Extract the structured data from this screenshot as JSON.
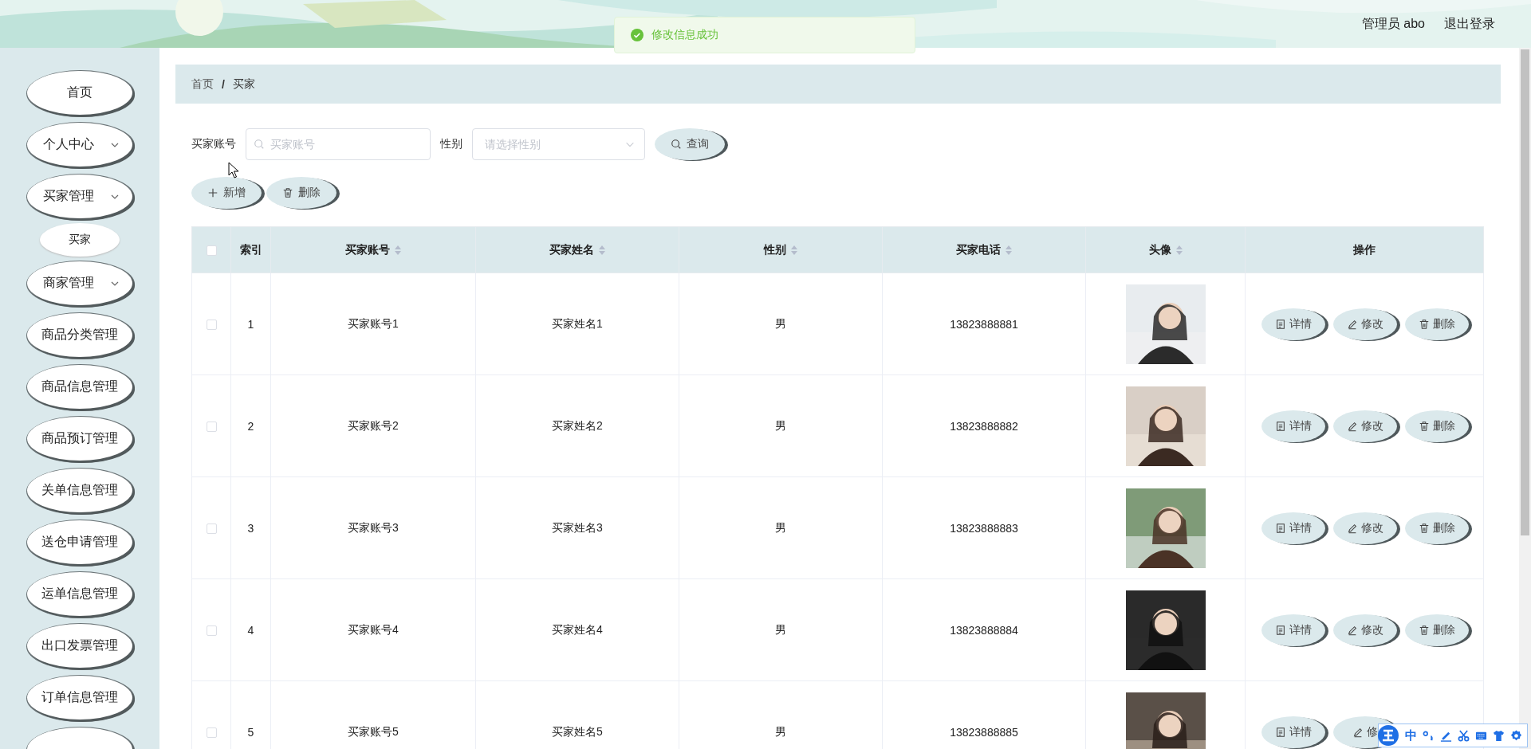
{
  "header": {
    "user": "管理员 abo",
    "logout": "退出登录"
  },
  "toast": {
    "kind": "success",
    "message": "修改信息成功"
  },
  "sidebar": {
    "items": [
      {
        "label": "首页",
        "kind": "link"
      },
      {
        "label": "个人中心",
        "kind": "submenu"
      },
      {
        "label": "买家管理",
        "kind": "submenu",
        "children": [
          {
            "label": "买家"
          }
        ]
      },
      {
        "label": "商家管理",
        "kind": "submenu"
      },
      {
        "label": "商品分类管理",
        "kind": "link"
      },
      {
        "label": "商品信息管理",
        "kind": "link"
      },
      {
        "label": "商品预订管理",
        "kind": "link"
      },
      {
        "label": "关单信息管理",
        "kind": "link"
      },
      {
        "label": "送仓申请管理",
        "kind": "link"
      },
      {
        "label": "运单信息管理",
        "kind": "link"
      },
      {
        "label": "出口发票管理",
        "kind": "link"
      },
      {
        "label": "订单信息管理",
        "kind": "link"
      },
      {
        "kind": "link"
      }
    ]
  },
  "breadcrumb": {
    "items": [
      "首页",
      "买家"
    ],
    "separator": "/"
  },
  "filters": {
    "account": {
      "label": "买家账号",
      "placeholder": "买家账号"
    },
    "gender": {
      "label": "性别",
      "placeholder": "请选择性别"
    },
    "search_button": "查询"
  },
  "toolbar": [
    {
      "kind": "add",
      "label": "新增"
    },
    {
      "kind": "delete",
      "label": "删除"
    }
  ],
  "table": {
    "columns": [
      {
        "kind": "checkbox",
        "checked": false
      },
      {
        "kind": "text",
        "label": "索引",
        "sortable": false
      },
      {
        "kind": "text",
        "label": "买家账号",
        "sortable": true
      },
      {
        "kind": "text",
        "label": "买家姓名",
        "sortable": true
      },
      {
        "kind": "text",
        "label": "性别",
        "sortable": true
      },
      {
        "kind": "text",
        "label": "买家电话",
        "sortable": true
      },
      {
        "kind": "text",
        "label": "头像",
        "sortable": true
      },
      {
        "kind": "text",
        "label": "操作",
        "sortable": false
      }
    ],
    "rows": [
      {
        "checked": false,
        "index": "1",
        "account": "买家账号1",
        "name": "买家姓名1",
        "gender": "男",
        "phone": "13823888881",
        "avatar": {
          "kind": "picture"
        },
        "actions": [
          {
            "kind": "detail",
            "label": "详情"
          },
          {
            "kind": "edit",
            "label": "修改"
          },
          {
            "kind": "delete",
            "label": "删除"
          }
        ]
      },
      {
        "checked": false,
        "index": "2",
        "account": "买家账号2",
        "name": "买家姓名2",
        "gender": "男",
        "phone": "13823888882",
        "avatar": {
          "kind": "picture"
        },
        "actions": [
          {
            "kind": "detail",
            "label": "详情"
          },
          {
            "kind": "edit",
            "label": "修改"
          },
          {
            "kind": "delete",
            "label": "删除"
          }
        ]
      },
      {
        "checked": false,
        "index": "3",
        "account": "买家账号3",
        "name": "买家姓名3",
        "gender": "男",
        "phone": "13823888883",
        "avatar": {
          "kind": "picture"
        },
        "actions": [
          {
            "kind": "detail",
            "label": "详情"
          },
          {
            "kind": "edit",
            "label": "修改"
          },
          {
            "kind": "delete",
            "label": "删除"
          }
        ]
      },
      {
        "checked": false,
        "index": "4",
        "account": "买家账号4",
        "name": "买家姓名4",
        "gender": "男",
        "phone": "13823888884",
        "avatar": {
          "kind": "picture"
        },
        "actions": [
          {
            "kind": "detail",
            "label": "详情"
          },
          {
            "kind": "edit",
            "label": "修改"
          },
          {
            "kind": "delete",
            "label": "删除"
          }
        ]
      },
      {
        "checked": false,
        "index": "5",
        "account": "买家账号5",
        "name": "买家姓名5",
        "gender": "男",
        "phone": "13823888885",
        "avatar": {
          "kind": "picture"
        },
        "actions": [
          {
            "kind": "detail",
            "label": "详情"
          },
          {
            "kind": "edit",
            "label": "修"
          }
        ]
      }
    ]
  },
  "ime_bar": {
    "mode": "中"
  }
}
